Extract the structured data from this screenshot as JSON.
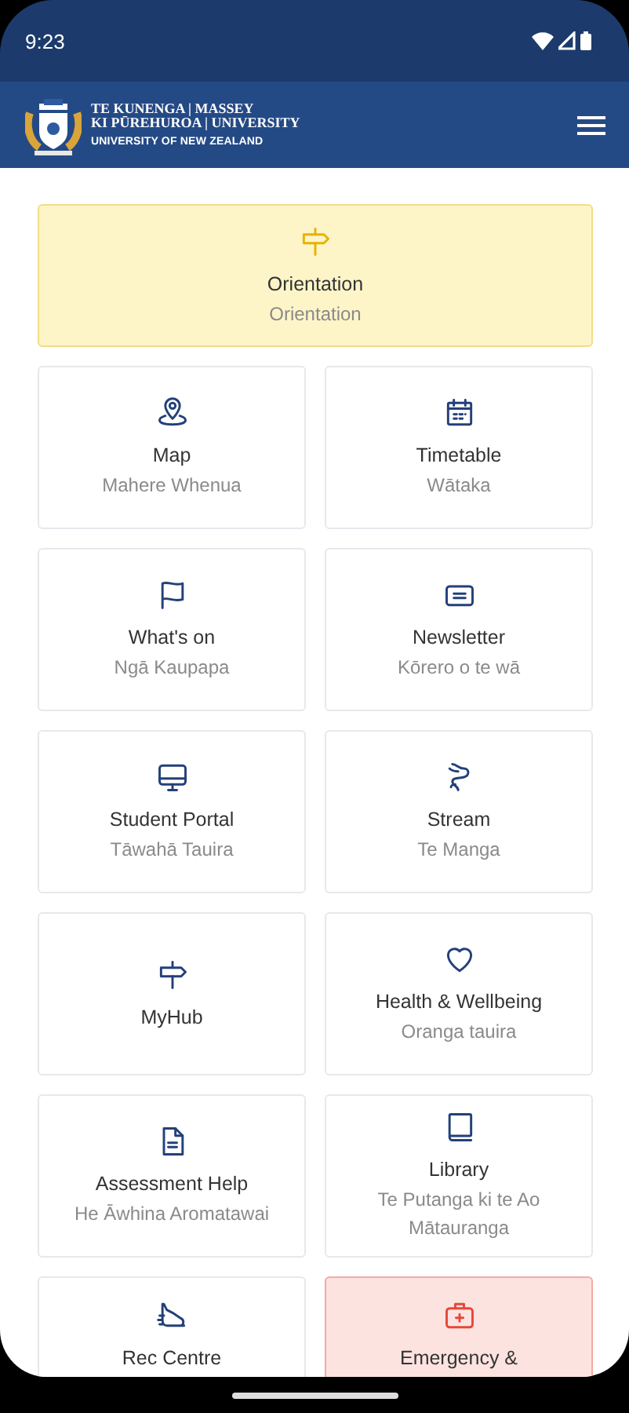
{
  "status_bar": {
    "time": "9:23"
  },
  "header": {
    "logo_lines": [
      "TE KUNENGA | MASSEY",
      "KI PŪREHUROA | UNIVERSITY"
    ],
    "logo_tagline": "UNIVERSITY OF NEW ZEALAND"
  },
  "tiles": [
    {
      "title": "Orientation",
      "subtitle": "Orientation",
      "kind": "highlight"
    },
    {
      "title": "Map",
      "subtitle": "Mahere Whenua",
      "kind": "normal"
    },
    {
      "title": "Timetable",
      "subtitle": "Wātaka",
      "kind": "normal"
    },
    {
      "title": "What's on",
      "subtitle": "Ngā Kaupapa",
      "kind": "normal"
    },
    {
      "title": "Newsletter",
      "subtitle": "Kōrero o te wā",
      "kind": "normal"
    },
    {
      "title": "Student Portal",
      "subtitle": "Tāwahā Tauira",
      "kind": "normal"
    },
    {
      "title": "Stream",
      "subtitle": "Te Manga",
      "kind": "normal"
    },
    {
      "title": "MyHub",
      "kind": "normal"
    },
    {
      "title": "Health & Wellbeing",
      "subtitle": "Oranga tauira",
      "kind": "normal"
    },
    {
      "title": "Assessment Help",
      "subtitle": "He Āwhina Aromatawai",
      "kind": "normal"
    },
    {
      "title": "Library",
      "subtitle": "Te Putanga ki te Ao Mātauranga",
      "kind": "normal"
    },
    {
      "title": "Rec Centre",
      "kind": "normal"
    },
    {
      "title": "Emergency &",
      "kind": "emergency"
    }
  ]
}
